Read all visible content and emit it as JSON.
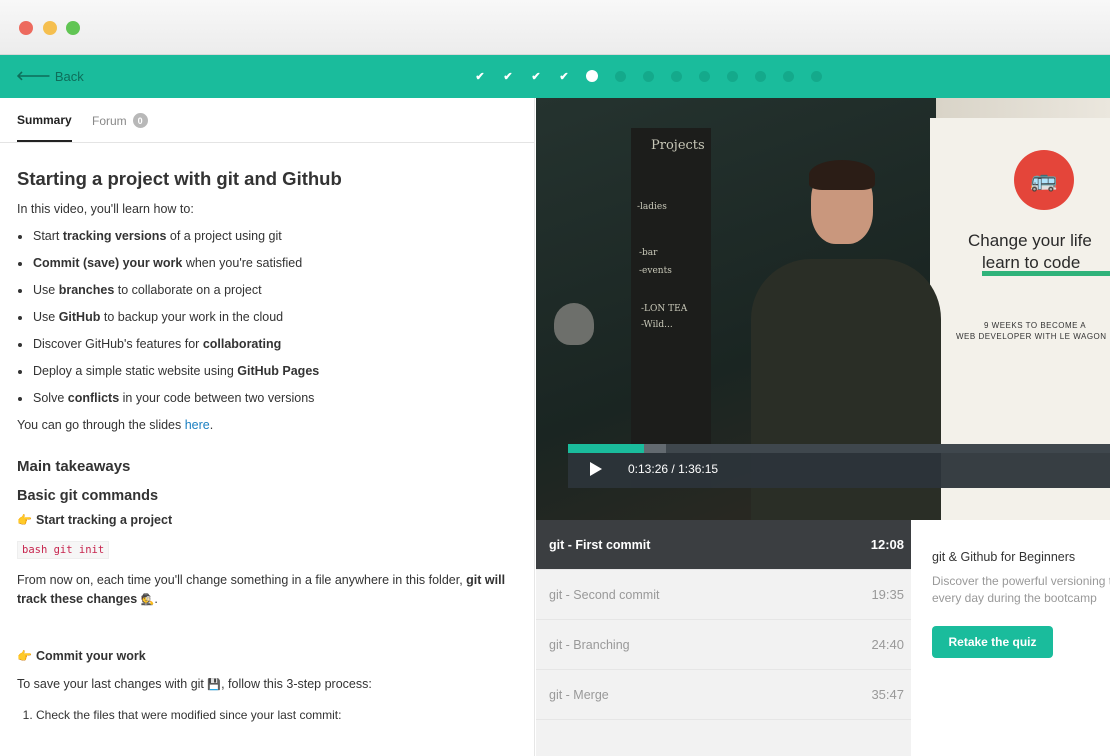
{
  "topbar": {
    "back_label": "Back",
    "progress": {
      "completed": 4,
      "current_index": 5,
      "total": 13
    }
  },
  "tabs": {
    "summary": "Summary",
    "forum": "Forum",
    "forum_count": "0"
  },
  "summary": {
    "title": "Starting a project with git and Github",
    "intro": "In this video, you'll learn how to:",
    "learn_items": [
      {
        "pre": "Start ",
        "bold": "tracking versions",
        "post": " of a project using git"
      },
      {
        "pre": "",
        "bold": "Commit (save) your work",
        "post": " when you're satisfied"
      },
      {
        "pre": "Use ",
        "bold": "branches",
        "post": " to collaborate on a project"
      },
      {
        "pre": "Use ",
        "bold": "GitHub",
        "post": " to backup your work in the cloud"
      },
      {
        "pre": "Discover GitHub's features for ",
        "bold": "collaborating",
        "post": ""
      },
      {
        "pre": "Deploy a simple static website using ",
        "bold": "GitHub Pages",
        "post": ""
      },
      {
        "pre": "Solve ",
        "bold": "conflicts",
        "post": " in your code between two versions"
      }
    ],
    "slides_pre": "You can go through the slides ",
    "slides_link": "here",
    "slides_post": ".",
    "takeaways_title": "Main takeaways",
    "basic_title": "Basic git commands",
    "step1_title": "Start tracking a project",
    "step1_code": "bash git init",
    "step1_text_pre": "From now on, each time you'll change something in a file anywhere in this folder, ",
    "step1_text_bold": "git will track these changes",
    "step1_text_post": ".",
    "step1_emoji": "🕵",
    "step2_title": "Commit your work",
    "step2_text_pre": "To save your last changes with git ",
    "step2_emoji": "💾",
    "step2_text_post": ", follow this 3-step process:",
    "ordered": [
      "Check the files that were modified since your last commit:"
    ]
  },
  "video": {
    "current_time": "0:13:26",
    "duration": "1:36:15",
    "progress_fraction": 0.14,
    "buffered_fraction": 0.18,
    "banner_title_line1": "Change your life",
    "banner_title_line2": "learn to code",
    "banner_sub_line1": "9 WEEKS TO BECOME A",
    "banner_sub_line2": "WEB DEVELOPER WITH LE WAGON",
    "board_text": [
      "Projects",
      "-ladies",
      "-bar",
      "-events",
      "-LON TEA",
      "-Wild..."
    ]
  },
  "playlist": [
    {
      "title": "git - First commit",
      "duration": "12:08",
      "active": true
    },
    {
      "title": "git - Second commit",
      "duration": "19:35",
      "active": false
    },
    {
      "title": "git - Branching",
      "duration": "24:40",
      "active": false
    },
    {
      "title": "git - Merge",
      "duration": "35:47",
      "active": false
    }
  ],
  "course": {
    "title": "git & Github for Beginners",
    "description": "Discover the powerful versioning tool we'll use every day during the bootcamp",
    "retake_label": "Retake the quiz"
  },
  "colors": {
    "accent": "#1abc9c",
    "playlist_active": "#3b3e41"
  }
}
